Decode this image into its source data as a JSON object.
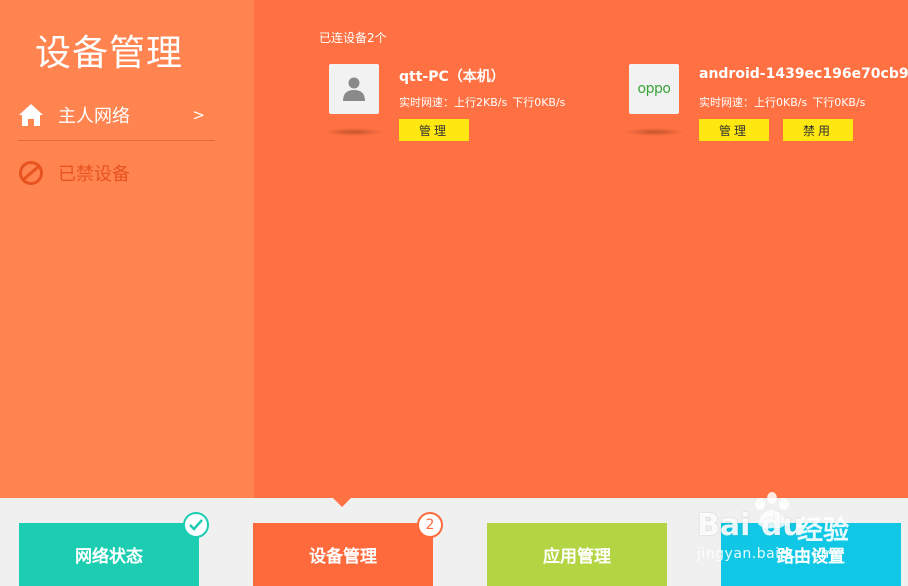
{
  "sidebar": {
    "title": "设备管理",
    "items": [
      {
        "label": "主人网络",
        "arrow": ">",
        "icon": "home-icon"
      },
      {
        "label": "已禁设备",
        "icon": "blocked-icon"
      }
    ]
  },
  "main": {
    "connected_label": "已连设备2个",
    "devices": [
      {
        "name": "qtt-PC（本机）",
        "speed_label": "实时网速：上行2KB/s",
        "down": "下行0KB/s",
        "icon": "user-icon",
        "manage": "管理"
      },
      {
        "name": "android-1439ec196e70cb9",
        "speed_label": "实时网速：上行0KB/s",
        "down": "下行0KB/s",
        "icon": "oppo-logo-icon",
        "logo_text": "oppo",
        "manage": "管理",
        "ban": "禁用"
      }
    ]
  },
  "tabs": [
    {
      "label": "网络状态",
      "color": "#1ccdb1"
    },
    {
      "label": "设备管理",
      "color": "#ff6a3c",
      "badge": "2"
    },
    {
      "label": "应用管理",
      "color": "#b3d443"
    },
    {
      "label": "路由设置",
      "color": "#10c8e6"
    }
  ],
  "watermark": {
    "logo": "Bai du",
    "brand": "经验",
    "url": "jingyan.baidu.com"
  },
  "colors": {
    "sidebar": "#ff8450",
    "main": "#ff7142",
    "button": "#ffe711"
  }
}
